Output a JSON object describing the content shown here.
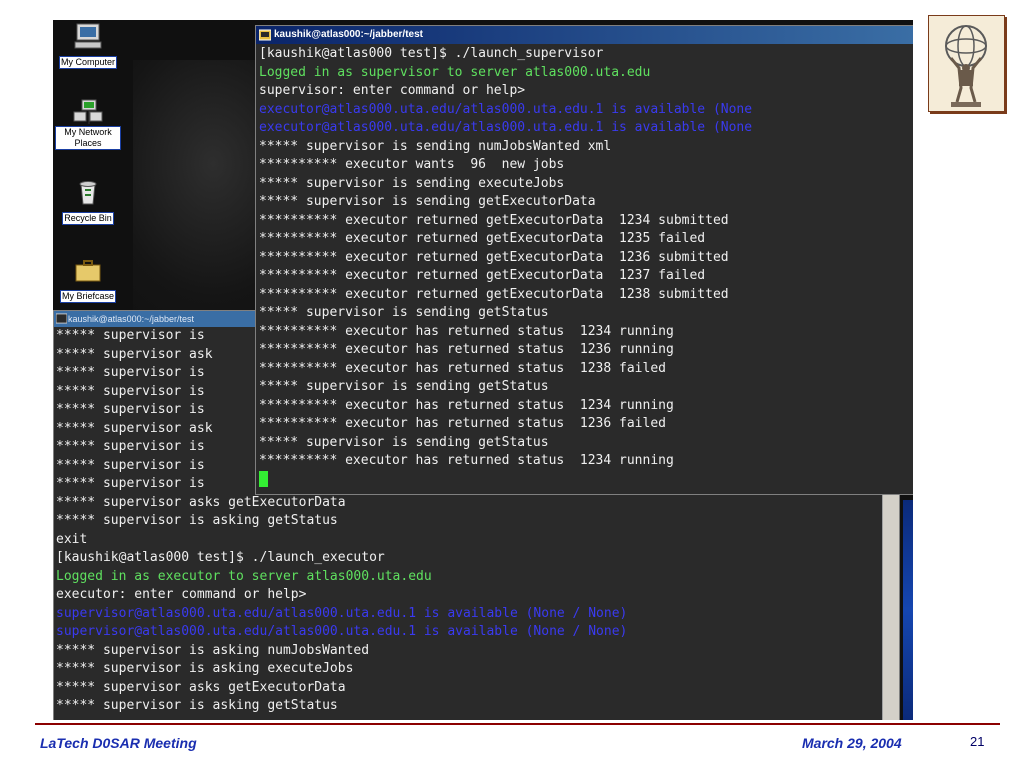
{
  "desktop": {
    "icons": [
      {
        "label": "My Computer",
        "icon": "computer-icon"
      },
      {
        "label": "My Network Places",
        "icon": "network-places-icon"
      },
      {
        "label": "Recycle Bin",
        "icon": "recycle-bin-icon"
      },
      {
        "label": "My Briefcase",
        "icon": "briefcase-icon"
      }
    ]
  },
  "front_terminal": {
    "title": "kaushik@atlas000:~/jabber/test",
    "lines": [
      {
        "text": "[kaushik@atlas000 test]$ ./launch_supervisor",
        "color": "white"
      },
      {
        "text": "Logged in as supervisor to server atlas000.uta.edu",
        "color": "green"
      },
      {
        "text": "supervisor: enter command or help>",
        "color": "white"
      },
      {
        "text": "executor@atlas000.uta.edu/atlas000.uta.edu.1 is available (None",
        "color": "blue"
      },
      {
        "text": "executor@atlas000.uta.edu/atlas000.uta.edu.1 is available (None",
        "color": "blue"
      },
      {
        "text": "***** supervisor is sending numJobsWanted xml",
        "color": "white"
      },
      {
        "text": "********** executor wants  96  new jobs",
        "color": "white"
      },
      {
        "text": "***** supervisor is sending executeJobs",
        "color": "white"
      },
      {
        "text": "***** supervisor is sending getExecutorData",
        "color": "white"
      },
      {
        "text": "********** executor returned getExecutorData  1234 submitted",
        "color": "white"
      },
      {
        "text": "********** executor returned getExecutorData  1235 failed",
        "color": "white"
      },
      {
        "text": "********** executor returned getExecutorData  1236 submitted",
        "color": "white"
      },
      {
        "text": "********** executor returned getExecutorData  1237 failed",
        "color": "white"
      },
      {
        "text": "********** executor returned getExecutorData  1238 submitted",
        "color": "white"
      },
      {
        "text": "***** supervisor is sending getStatus",
        "color": "white"
      },
      {
        "text": "********** executor has returned status  1234 running",
        "color": "white"
      },
      {
        "text": "********** executor has returned status  1236 running",
        "color": "white"
      },
      {
        "text": "********** executor has returned status  1238 failed",
        "color": "white"
      },
      {
        "text": "***** supervisor is sending getStatus",
        "color": "white"
      },
      {
        "text": "********** executor has returned status  1234 running",
        "color": "white"
      },
      {
        "text": "********** executor has returned status  1236 failed",
        "color": "white"
      },
      {
        "text": "***** supervisor is sending getStatus",
        "color": "white"
      },
      {
        "text": "********** executor has returned status  1234 running",
        "color": "white"
      }
    ]
  },
  "back_terminal": {
    "title": "kaushik@atlas000:~/jabber/test",
    "hidden_lines": [
      "***** supervisor is",
      "***** supervisor ask",
      "***** supervisor is",
      "***** supervisor is",
      "***** supervisor is",
      "***** supervisor ask",
      "***** supervisor is",
      "***** supervisor is",
      "***** supervisor is"
    ],
    "lines": [
      {
        "text": "***** supervisor asks getExecutorData",
        "color": "white"
      },
      {
        "text": "***** supervisor is asking getStatus",
        "color": "white"
      },
      {
        "text": "exit",
        "color": "white"
      },
      {
        "text": "[kaushik@atlas000 test]$ ./launch_executor",
        "color": "white"
      },
      {
        "text": "Logged in as executor to server atlas000.uta.edu",
        "color": "green"
      },
      {
        "text": "executor: enter command or help>",
        "color": "white"
      },
      {
        "text": "supervisor@atlas000.uta.edu/atlas000.uta.edu.1 is available (None / None)",
        "color": "blue"
      },
      {
        "text": "supervisor@atlas000.uta.edu/atlas000.uta.edu.1 is available (None / None)",
        "color": "blue"
      },
      {
        "text": "***** supervisor is asking numJobsWanted",
        "color": "white"
      },
      {
        "text": "***** supervisor is asking executeJobs",
        "color": "white"
      },
      {
        "text": "***** supervisor asks getExecutorData",
        "color": "white"
      },
      {
        "text": "***** supervisor is asking getStatus",
        "color": "white"
      }
    ]
  },
  "footer": {
    "left": "LaTech D0SAR Meeting",
    "right": "March 29, 2004",
    "page": "21"
  },
  "colors": {
    "terminal_bg": "#2a2a2a",
    "green_text": "#5fe05f",
    "blue_text": "#3a3af0",
    "footer_text": "#1a2eb0",
    "footer_rule": "#8b0000"
  }
}
